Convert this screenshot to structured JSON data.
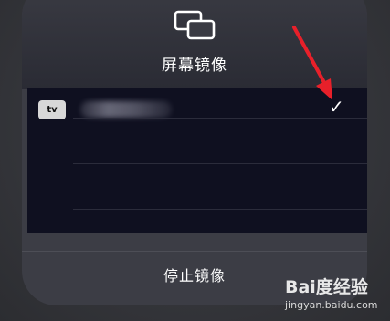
{
  "panel": {
    "title": "屏幕镜像",
    "icon": "screen-mirroring-icon"
  },
  "devices": [
    {
      "badge": " tv",
      "name": "",
      "selected": true,
      "check": "✓"
    }
  ],
  "footer": {
    "stop_label": "停止镜像"
  },
  "watermark": {
    "logo": "Bai度经验",
    "url": "jingyan.baidu.com"
  },
  "colors": {
    "panel_bg": "#3c3d45",
    "list_bg": "#0f1020",
    "arrow": "#e8202a"
  }
}
